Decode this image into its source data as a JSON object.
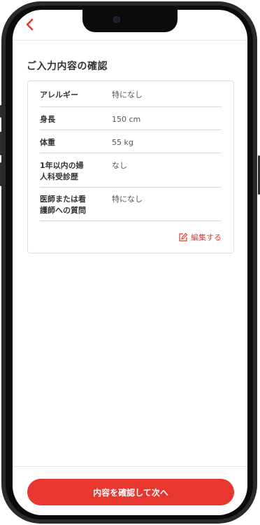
{
  "header": {
    "back_icon": "chevron-left-icon",
    "accent_color": "#e8372f"
  },
  "page": {
    "title": "ご入力内容の確認"
  },
  "summary": {
    "rows": [
      {
        "label": "アレルギー",
        "value": "特になし"
      },
      {
        "label": "身長",
        "value": "150 cm"
      },
      {
        "label": "体重",
        "value": "55 kg"
      },
      {
        "label": "1年以内の婦\n人科受診歴",
        "value": "なし"
      },
      {
        "label": "医師または看\n護師への質問",
        "value": "特になし"
      }
    ],
    "edit_label": "編集する",
    "edit_icon": "edit-icon"
  },
  "footer": {
    "cta_label": "内容を確認して次へ"
  }
}
